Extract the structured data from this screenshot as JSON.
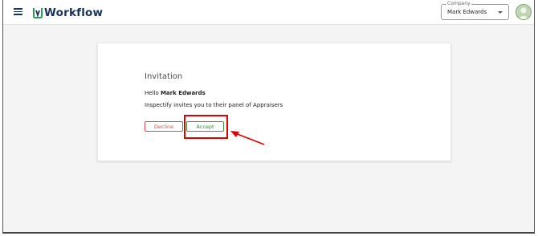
{
  "header": {
    "logo_text": "Workflow",
    "company_label": "Company",
    "company_value": "Mark Edwards"
  },
  "invitation": {
    "title": "Invitation",
    "hello_prefix": "Hello ",
    "user_name": "Mark Edwards",
    "message": "Inspectify invites you to their panel of Appraisers",
    "decline_label": "Decline",
    "accept_label": "Accept"
  },
  "colors": {
    "brand_navy": "#16325c",
    "decline_red": "#e04a4a",
    "accept_green": "#2f8a2f",
    "highlight_red": "#e00000"
  }
}
